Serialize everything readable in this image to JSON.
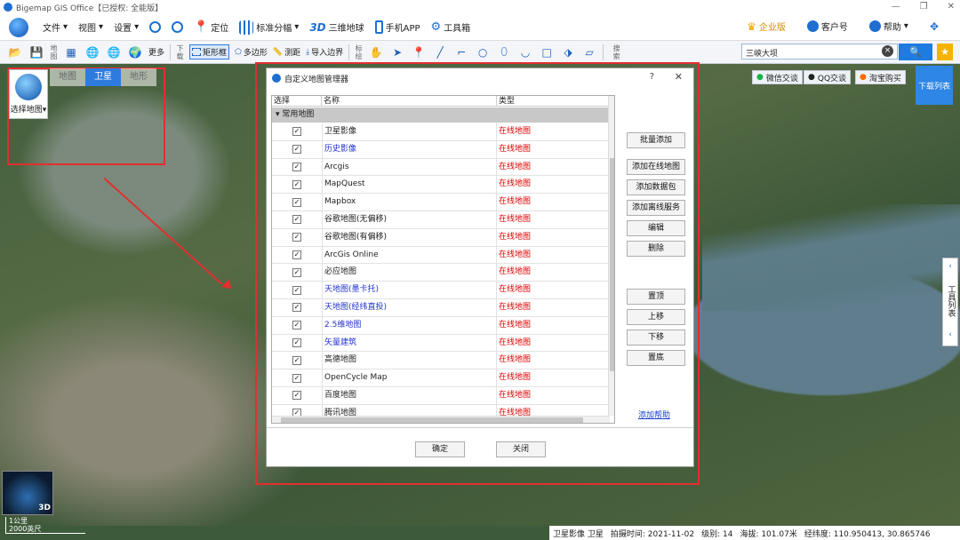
{
  "app": {
    "title": "Bigemap GIS Office【已授权: 全能版】",
    "window_controls": [
      "—",
      "❐",
      "✕"
    ]
  },
  "menu": {
    "items": [
      {
        "label": "文件",
        "icon": "file-icon"
      },
      {
        "label": "视图",
        "icon": "view-icon"
      },
      {
        "label": "设置",
        "icon": "settings-icon"
      },
      {
        "label": "",
        "icon": "zoom-in-icon"
      },
      {
        "label": "",
        "icon": "zoom-out-icon"
      },
      {
        "label": "定位",
        "icon": "location-pin-icon"
      },
      {
        "label": "标准分幅",
        "icon": "grid-icon"
      },
      {
        "label": "三维地球",
        "icon": "3d-icon"
      },
      {
        "label": "手机APP",
        "icon": "phone-icon"
      },
      {
        "label": "工具箱",
        "icon": "gear-icon"
      }
    ],
    "right": {
      "enterprise": "企业版",
      "account": "客户号",
      "help": "帮助"
    }
  },
  "toolbar": {
    "more": "更多",
    "vlabel_map": "地图",
    "vlabel_download": "下载",
    "vlabel_mark": "标绘",
    "vlabel_search": "搜索",
    "rect": "矩形框",
    "polygon": "多边形",
    "measure": "测距",
    "import_border": "导入边界"
  },
  "search": {
    "value": "三峡大坝",
    "clear": "×",
    "button": "🔍",
    "star": "★"
  },
  "map_types": {
    "select_label": "选择地图",
    "tabs": [
      "地图",
      "卫星",
      "地形"
    ],
    "active": 1
  },
  "social": {
    "wechat": "微信交谈",
    "qq": "QQ交谈",
    "taobao": "淘宝购买"
  },
  "download_list": "下载列表",
  "side_tools": "工具列表",
  "dialog": {
    "title": "自定义地图管理器",
    "help": "?",
    "close": "✕",
    "columns": [
      "选择",
      "名称",
      "类型"
    ],
    "group": "常用地图",
    "rows": [
      {
        "name": "卫星影像",
        "type": "在线地图",
        "blue": false
      },
      {
        "name": "历史影像",
        "type": "在线地图",
        "blue": true
      },
      {
        "name": "Arcgis",
        "type": "在线地图",
        "blue": false
      },
      {
        "name": "MapQuest",
        "type": "在线地图",
        "blue": false
      },
      {
        "name": "Mapbox",
        "type": "在线地图",
        "blue": false
      },
      {
        "name": "谷歌地图(无偏移)",
        "type": "在线地图",
        "blue": false
      },
      {
        "name": "谷歌地图(有偏移)",
        "type": "在线地图",
        "blue": false
      },
      {
        "name": "ArcGis Online",
        "type": "在线地图",
        "blue": false
      },
      {
        "name": "必应地图",
        "type": "在线地图",
        "blue": false
      },
      {
        "name": "天地图(墨卡托)",
        "type": "在线地图",
        "blue": true
      },
      {
        "name": "天地图(经纬直投)",
        "type": "在线地图",
        "blue": true
      },
      {
        "name": "2.5维地图",
        "type": "在线地图",
        "blue": true
      },
      {
        "name": "矢量建筑",
        "type": "在线地图",
        "blue": true
      },
      {
        "name": "高德地图",
        "type": "在线地图",
        "blue": false
      },
      {
        "name": "OpenCycle Map",
        "type": "在线地图",
        "blue": false
      },
      {
        "name": "百度地图",
        "type": "在线地图",
        "blue": false
      },
      {
        "name": "腾讯地图",
        "type": "在线地图",
        "blue": false
      }
    ],
    "buttons_top": [
      "批量添加",
      "添加在线地图",
      "添加数据包",
      "添加离线服务",
      "编辑",
      "删除"
    ],
    "buttons_order": [
      "置顶",
      "上移",
      "下移",
      "置底"
    ],
    "help_link": "添加帮助",
    "ok": "确定",
    "cancel": "关闭"
  },
  "globe": {
    "label": "3D"
  },
  "scale": {
    "km": "1公里",
    "ft": "2000英尺"
  },
  "status": {
    "layer": "卫星影像 卫星",
    "capture": "拍摄时间: 2021-11-02",
    "level": "级别: 14",
    "altitude": "海拔: 101.07米",
    "coords": "经纬度: 110.950413, 30.865746"
  },
  "colors": {
    "accent": "#2e7be0",
    "highlight": "#e03030",
    "online_type": "#dd0000"
  }
}
